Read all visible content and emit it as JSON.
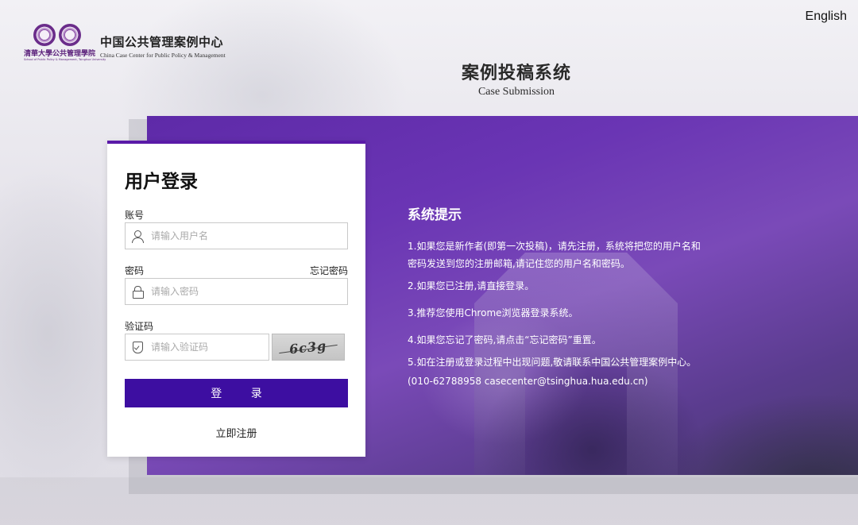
{
  "header": {
    "logo_calligraphy": "清華大學公共管理學院",
    "logo_subtitle": "School of Public Policy & Management, Tsinghua University",
    "brand_cn": "中国公共管理案例中心",
    "brand_en": "China Case Center for Public Policy & Management",
    "language_link": "English"
  },
  "system": {
    "title_cn": "案例投稿系统",
    "title_en": "Case Submission"
  },
  "login": {
    "title": "用户登录",
    "account_label": "账号",
    "account_placeholder": "请输入用户名",
    "password_label": "密码",
    "forgot_password": "忘记密码",
    "password_placeholder": "请输入密码",
    "captcha_label": "验证码",
    "captcha_placeholder": "请输入验证码",
    "captcha_text": "6c3g",
    "login_button": "登 录",
    "register_link": "立即注册"
  },
  "tips": {
    "title": "系统提示",
    "items": [
      "1.如果您是新作者(即第一次投稿)，请先注册，系统将把您的用户名和",
      "密码发送到您的注册邮箱,请记住您的用户名和密码。",
      "2.如果您已注册,请直接登录。",
      "3.推荐您使用Chrome浏览器登录系统。",
      "4.如果您忘记了密码,请点击“忘记密码”重置。",
      "5.如在注册或登录过程中出现问题,敬请联系中国公共管理案例中心。",
      "(010-62788958 casecenter@tsinghua.hua.edu.cn)"
    ]
  },
  "colors": {
    "accent": "#3d0ea1",
    "banner": "#6a35b4"
  },
  "icons": {
    "account": "user-icon",
    "password": "lock-icon",
    "captcha": "shield-icon"
  }
}
